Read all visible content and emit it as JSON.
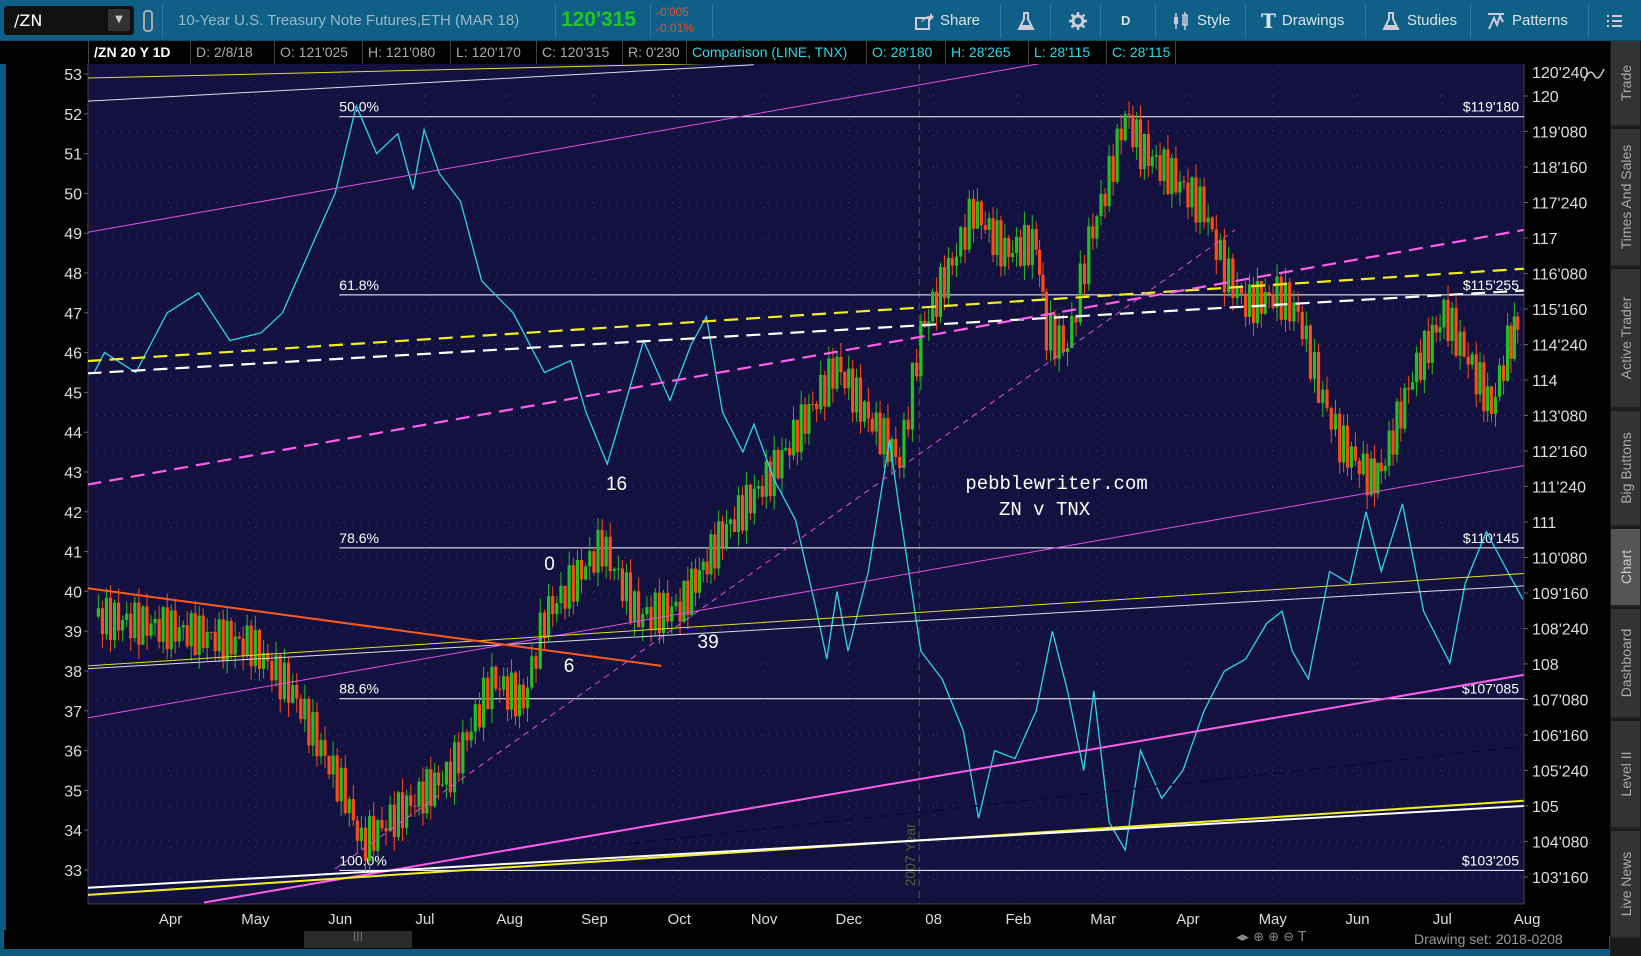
{
  "toolbar": {
    "symbol": "/ZN",
    "description": "10-Year U.S. Treasury Note Futures,ETH (MAR 18)",
    "last": "120'315",
    "change": "-0'005",
    "change_pct": "-0.01%",
    "buttons": [
      {
        "label": "Share",
        "icon": "share-icon"
      },
      {
        "label": "",
        "icon": "flask-icon"
      },
      {
        "label": "",
        "icon": "gear-icon"
      },
      {
        "label": "D",
        "icon": ""
      },
      {
        "label": "Style",
        "icon": "candle-style-icon"
      },
      {
        "label": "Drawings",
        "icon": "drawings-t-icon"
      },
      {
        "label": "Studies",
        "icon": "flask-icon"
      },
      {
        "label": "Patterns",
        "icon": "patterns-icon"
      },
      {
        "label": "",
        "icon": "menu-icon"
      }
    ]
  },
  "infobar": {
    "title": "/ZN 20 Y 1D",
    "date": "D: 2/8/18",
    "open": "O: 121'025",
    "high": "H: 121'080",
    "low": "L: 120'170",
    "close": "C: 120'315",
    "range": "R: 0'230",
    "comparison": "Comparison (LINE, TNX)",
    "cmp_open": "O: 28'180",
    "cmp_high": "H: 28'265",
    "cmp_low": "L: 28'115",
    "cmp_close": "C: 28'115"
  },
  "side_tabs": [
    "Trade",
    "Times And Sales",
    "Active Trader",
    "Big Buttons",
    "Chart",
    "Dashboard",
    "Level II",
    "Live News"
  ],
  "active_tab": "Chart",
  "bottom": {
    "drawing_set": "Drawing set: 2018-0208",
    "scroll_thumb": "|||"
  },
  "colors": {
    "background": "#12113f",
    "up": "#22c022",
    "down": "#ff4a1a",
    "tnx": "#2ad8e8",
    "magenta": "#ff5ee8",
    "yellow": "#f0f020",
    "white": "#ffffff",
    "orange": "#ff5a1e"
  },
  "chart_data": {
    "type": "candlestick+line",
    "title": "/ZN 20 Y 1D",
    "x_unit": "months since Apr 2017",
    "xlim": [
      -0.98,
      15.97
    ],
    "x_ticks": [
      {
        "v": 0,
        "label": "Apr"
      },
      {
        "v": 1,
        "label": "May"
      },
      {
        "v": 2,
        "label": "Jun"
      },
      {
        "v": 3,
        "label": "Jul"
      },
      {
        "v": 4,
        "label": "Aug"
      },
      {
        "v": 5,
        "label": "Sep"
      },
      {
        "v": 6,
        "label": "Oct"
      },
      {
        "v": 7,
        "label": "Nov"
      },
      {
        "v": 8,
        "label": "Dec"
      },
      {
        "v": 9,
        "label": "08"
      },
      {
        "v": 10,
        "label": "Feb"
      },
      {
        "v": 11,
        "label": "Mar"
      },
      {
        "v": 12,
        "label": "Apr"
      },
      {
        "v": 13,
        "label": "May"
      },
      {
        "v": 14,
        "label": "Jun"
      },
      {
        "v": 15,
        "label": "Jul"
      },
      {
        "v": 16,
        "label": "Aug"
      }
    ],
    "right_axis": {
      "range": [
        102.5,
        120.75
      ],
      "ticks": [
        {
          "v": 120.75,
          "label": "120'240"
        },
        {
          "v": 120,
          "label": "120"
        },
        {
          "v": 119.25,
          "label": "119'080"
        },
        {
          "v": 118.5,
          "label": "118'160"
        },
        {
          "v": 117.75,
          "label": "117'240"
        },
        {
          "v": 117,
          "label": "117"
        },
        {
          "v": 116.25,
          "label": "116'080"
        },
        {
          "v": 115.5,
          "label": "115'160"
        },
        {
          "v": 114.75,
          "label": "114'240"
        },
        {
          "v": 114,
          "label": "114"
        },
        {
          "v": 113.25,
          "label": "113'080"
        },
        {
          "v": 112.5,
          "label": "112'160"
        },
        {
          "v": 111.75,
          "label": "111'240"
        },
        {
          "v": 111,
          "label": "111"
        },
        {
          "v": 110.25,
          "label": "110'080"
        },
        {
          "v": 109.5,
          "label": "109'160"
        },
        {
          "v": 108.75,
          "label": "108'240"
        },
        {
          "v": 108,
          "label": "108"
        },
        {
          "v": 107.25,
          "label": "107'080"
        },
        {
          "v": 106.5,
          "label": "106'160"
        },
        {
          "v": 105.75,
          "label": "105'240"
        },
        {
          "v": 105,
          "label": "105"
        },
        {
          "v": 104.25,
          "label": "104'080"
        },
        {
          "v": 103.5,
          "label": "103'160"
        }
      ]
    },
    "left_axis": {
      "range": [
        32.3,
        53.3
      ],
      "ticks": [
        53,
        52,
        51,
        50,
        49,
        48,
        47,
        46,
        45,
        44,
        43,
        42,
        41,
        40,
        39,
        38,
        37,
        36,
        35,
        34,
        33
      ]
    },
    "zn_closes": [
      [
        -0.9,
        109.0
      ],
      [
        -0.04,
        108.76
      ],
      [
        0.95,
        108.4
      ],
      [
        1.44,
        107.4
      ],
      [
        2.06,
        105.2
      ],
      [
        2.25,
        104.2
      ],
      [
        2.93,
        105.2
      ],
      [
        3.3,
        105.7
      ],
      [
        3.79,
        107.65
      ],
      [
        4.16,
        107.2
      ],
      [
        4.41,
        109.0
      ],
      [
        5.09,
        110.5
      ],
      [
        5.52,
        109.0
      ],
      [
        6.01,
        109.2
      ],
      [
        6.51,
        110.75
      ],
      [
        7.12,
        112.1
      ],
      [
        7.62,
        113.6
      ],
      [
        7.86,
        114.3
      ],
      [
        8.23,
        113.2
      ],
      [
        8.6,
        112.3
      ],
      [
        8.85,
        115.0
      ],
      [
        9.22,
        116.5
      ],
      [
        9.47,
        117.6
      ],
      [
        9.84,
        116.7
      ],
      [
        10.21,
        116.9
      ],
      [
        10.33,
        115.0
      ],
      [
        10.58,
        114.7
      ],
      [
        10.83,
        116.9
      ],
      [
        11.07,
        118.3
      ],
      [
        11.26,
        119.6
      ],
      [
        11.44,
        118.9
      ],
      [
        11.81,
        118.3
      ],
      [
        12.19,
        117.6
      ],
      [
        12.43,
        116.3
      ],
      [
        12.68,
        115.6
      ],
      [
        13.05,
        115.8
      ],
      [
        13.3,
        115.4
      ],
      [
        13.54,
        113.85
      ],
      [
        13.79,
        112.7
      ],
      [
        14.16,
        111.9
      ],
      [
        14.28,
        112.1
      ],
      [
        14.65,
        114.1
      ],
      [
        15.02,
        115.4
      ],
      [
        15.4,
        114.1
      ],
      [
        15.58,
        113.4
      ],
      [
        15.77,
        114.7
      ],
      [
        15.89,
        115.2
      ]
    ],
    "tnx_series": {
      "name": "TNX",
      "axis": "left",
      "points": [
        [
          -0.9,
          45.5
        ],
        [
          -0.78,
          46
        ],
        [
          -0.41,
          45.5
        ],
        [
          -0.04,
          47
        ],
        [
          0.33,
          47.5
        ],
        [
          0.7,
          46.3
        ],
        [
          1.07,
          46.5
        ],
        [
          1.32,
          47
        ],
        [
          1.69,
          48.8
        ],
        [
          1.94,
          50
        ],
        [
          2.19,
          52.2
        ],
        [
          2.43,
          51
        ],
        [
          2.68,
          51.5
        ],
        [
          2.86,
          50.1
        ],
        [
          2.99,
          51.6
        ],
        [
          3.17,
          50.5
        ],
        [
          3.42,
          49.8
        ],
        [
          3.67,
          47.8
        ],
        [
          4.04,
          47
        ],
        [
          4.41,
          45.5
        ],
        [
          4.72,
          45.8
        ],
        [
          4.9,
          44.5
        ],
        [
          5.15,
          43.2
        ],
        [
          5.4,
          45
        ],
        [
          5.58,
          46.3
        ],
        [
          5.89,
          44.8
        ],
        [
          6.14,
          46.2
        ],
        [
          6.32,
          46.9
        ],
        [
          6.51,
          44.5
        ],
        [
          6.75,
          43.5
        ],
        [
          6.88,
          44.2
        ],
        [
          7.12,
          42.8
        ],
        [
          7.37,
          41.8
        ],
        [
          7.62,
          39.5
        ],
        [
          7.74,
          38.3
        ],
        [
          7.86,
          40
        ],
        [
          7.99,
          38.5
        ],
        [
          8.23,
          40.5
        ],
        [
          8.48,
          43.8
        ],
        [
          8.6,
          42
        ],
        [
          8.85,
          38.5
        ],
        [
          9.1,
          37.8
        ],
        [
          9.35,
          36.5
        ],
        [
          9.53,
          34.3
        ],
        [
          9.72,
          36
        ],
        [
          9.96,
          35.8
        ],
        [
          10.21,
          37
        ],
        [
          10.4,
          39
        ],
        [
          10.58,
          37.5
        ],
        [
          10.77,
          35.5
        ],
        [
          10.89,
          37.5
        ],
        [
          11.07,
          34.2
        ],
        [
          11.26,
          33.5
        ],
        [
          11.44,
          36
        ],
        [
          11.69,
          34.8
        ],
        [
          11.94,
          35.5
        ],
        [
          12.19,
          37
        ],
        [
          12.43,
          38
        ],
        [
          12.68,
          38.3
        ],
        [
          12.93,
          39.2
        ],
        [
          13.11,
          39.5
        ],
        [
          13.23,
          38.5
        ],
        [
          13.42,
          37.8
        ],
        [
          13.67,
          40.5
        ],
        [
          13.91,
          40.2
        ],
        [
          14.1,
          42
        ],
        [
          14.28,
          40.5
        ],
        [
          14.53,
          42.2
        ],
        [
          14.78,
          39.5
        ],
        [
          15.09,
          38.2
        ],
        [
          15.27,
          40.2
        ],
        [
          15.52,
          41.5
        ],
        [
          15.77,
          40.5
        ],
        [
          15.95,
          39.8
        ]
      ]
    },
    "fib_levels": [
      {
        "pct": "50.0%",
        "price": 119.5625,
        "label": "$119'180"
      },
      {
        "pct": "61.8%",
        "price": 115.797,
        "label": "$115'255"
      },
      {
        "pct": "78.6%",
        "price": 110.453,
        "label": "$110'145"
      },
      {
        "pct": "88.6%",
        "price": 107.266,
        "label": "$107'085"
      },
      {
        "pct": "100.0%",
        "price": 103.64,
        "label": "$103'205"
      }
    ],
    "fib_start_x": 1.99,
    "trendlines": [
      {
        "name": "yellow-top",
        "from": [
          -0.98,
          120.38
        ],
        "to": [
          6.88,
          120.71
        ],
        "color": "#e0e020",
        "width": 1,
        "dash": ""
      },
      {
        "name": "white-top",
        "from": [
          -0.98,
          119.89
        ],
        "to": [
          6.88,
          120.66
        ],
        "color": "#dddddd",
        "width": 1,
        "dash": ""
      },
      {
        "name": "magenta-upper",
        "from": [
          -0.98,
          117.12
        ],
        "to": [
          10.33,
          120.71
        ],
        "color": "#e050e0",
        "width": 1,
        "dash": ""
      },
      {
        "name": "yellow-dashed",
        "from": [
          -0.98,
          114.4
        ],
        "to": [
          15.96,
          116.35
        ],
        "color": "#f0f020",
        "width": 2.2,
        "dash": "14 8"
      },
      {
        "name": "white-dashed",
        "from": [
          -0.98,
          114.14
        ],
        "to": [
          15.96,
          115.89
        ],
        "color": "#ffffff",
        "width": 2.2,
        "dash": "14 8"
      },
      {
        "name": "magenta-dashed",
        "from": [
          -0.98,
          111.79
        ],
        "to": [
          15.96,
          117.17
        ],
        "color": "#ff5ee8",
        "width": 2.2,
        "dash": "14 8"
      },
      {
        "name": "magenta-diagonal",
        "from": [
          1.94,
          103.67
        ],
        "to": [
          12.556,
          117.17
        ],
        "color": "#e050e0",
        "width": 1,
        "dash": "6 5"
      },
      {
        "name": "magenta-mid",
        "from": [
          -0.98,
          106.86
        ],
        "to": [
          15.96,
          112.19
        ],
        "color": "#e050e0",
        "width": 1,
        "dash": ""
      },
      {
        "name": "yellow-mid",
        "from": [
          -0.98,
          107.96
        ],
        "to": [
          15.96,
          109.91
        ],
        "color": "#e0e020",
        "width": 1,
        "dash": ""
      },
      {
        "name": "white-mid",
        "from": [
          -0.98,
          107.9
        ],
        "to": [
          15.96,
          109.65
        ],
        "color": "#dddddd",
        "width": 1,
        "dash": ""
      },
      {
        "name": "orange-down",
        "from": [
          -0.98,
          109.6
        ],
        "to": [
          5.79,
          107.96
        ],
        "color": "#ff5a1e",
        "width": 2,
        "dash": ""
      },
      {
        "name": "magenta-lower",
        "from": [
          0.395,
          102.96
        ],
        "to": [
          15.96,
          107.77
        ],
        "color": "#ff5ee8",
        "width": 2,
        "dash": ""
      },
      {
        "name": "yellow-bottom",
        "from": [
          -0.98,
          103.12
        ],
        "to": [
          15.96,
          105.11
        ],
        "color": "#f0f020",
        "width": 2,
        "dash": ""
      },
      {
        "name": "white-bottom",
        "from": [
          -0.98,
          103.27
        ],
        "to": [
          15.96,
          105.0
        ],
        "color": "#ffffff",
        "width": 2,
        "dash": ""
      },
      {
        "name": "navy-dashed",
        "from": [
          5.4,
          104.2
        ],
        "to": [
          15.96,
          106.26
        ],
        "color": "#08083a",
        "width": 1.5,
        "dash": "12 6"
      }
    ],
    "year_marker": {
      "x": 8.83,
      "label": "2007 Year"
    },
    "annotations": [
      {
        "text": "16",
        "x": 5.26,
        "y": 111.68
      },
      {
        "text": "0",
        "x": 4.47,
        "y": 109.98
      },
      {
        "text": "6",
        "x": 4.7,
        "y": 107.83
      },
      {
        "text": "39",
        "x": 6.34,
        "y": 108.34
      }
    ],
    "watermark": {
      "line1": "pebblewriter.com",
      "line2": "ZN v TNX",
      "x": 10.45,
      "y": 111.7
    }
  }
}
